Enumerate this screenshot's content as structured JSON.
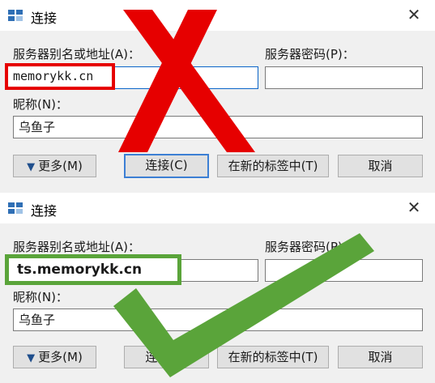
{
  "dialogs": [
    {
      "title": "连接",
      "alias_label": "服务器别名或地址(A)：",
      "password_label": "服务器密码(P)：",
      "alias_value": "",
      "password_value": "",
      "nick_label": "昵称(N)：",
      "nick_value": "乌鱼子",
      "more_button": "更多(M)",
      "connect_button": "连接(C)",
      "new_tab_button": "在新的标签中(T)",
      "cancel_button": "取消",
      "annotation_text": "memorykk.cn"
    },
    {
      "title": "连接",
      "alias_label": "服务器别名或地址(A)：",
      "password_label": "服务器密码(P)：",
      "alias_value": "",
      "password_value": "",
      "nick_label": "昵称(N)：",
      "nick_value": "乌鱼子",
      "more_button": "更多(M)",
      "connect_button": "连接(C)",
      "new_tab_button": "在新的标签中(T)",
      "cancel_button": "取消",
      "annotation_text": "ts.memorykk.cn"
    }
  ],
  "colors": {
    "wrong_mark": "#e60000",
    "right_mark": "#5aa43a",
    "default_button_border": "#3c7fd4"
  },
  "icons": {
    "window": "app-icon",
    "close": "close-icon",
    "more": "triangle-down-icon",
    "wrong": "red-x-mark",
    "right": "green-check-mark"
  }
}
